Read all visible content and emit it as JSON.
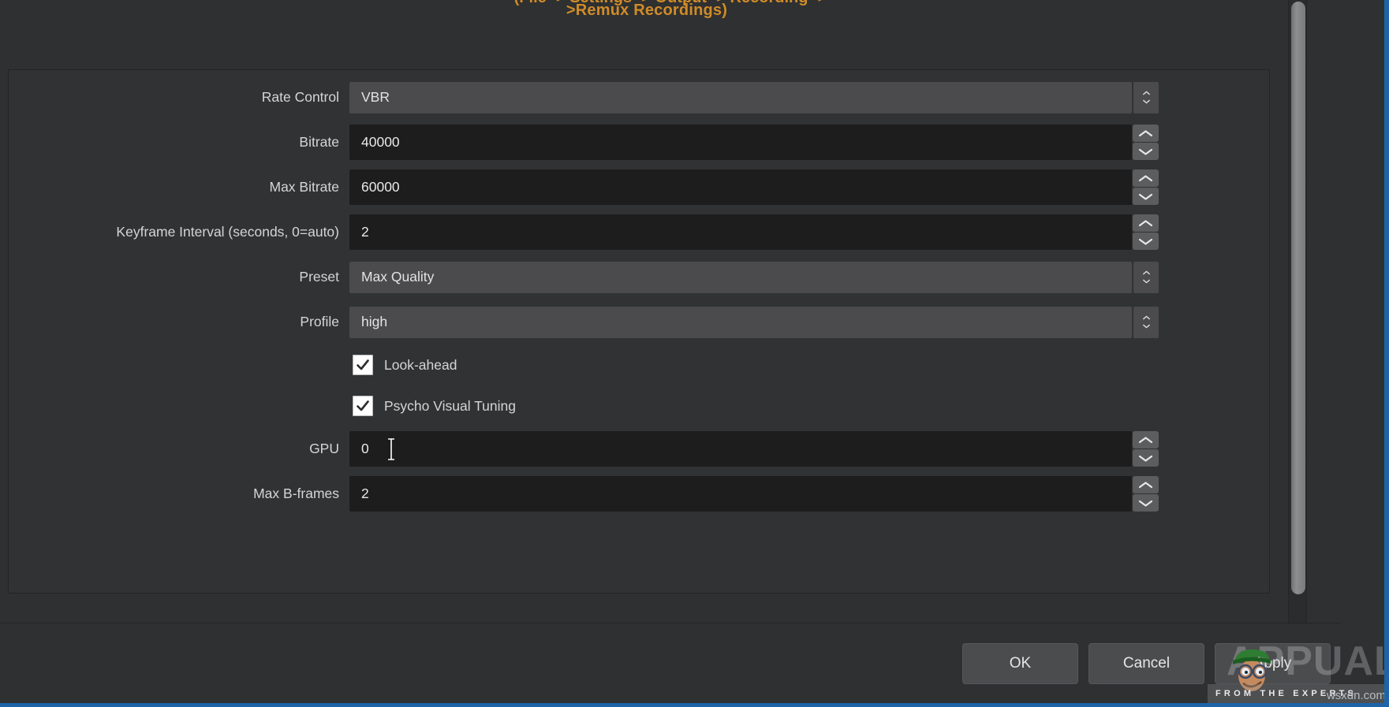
{
  "window": {
    "accent_color": "#1e64a8",
    "background_color": "#2f3031"
  },
  "settings": {
    "help_text": ">Remux Recordings)",
    "help_text_clipped_above": "(File -> Settings -> Output -> Recording ->",
    "help_text_color": "#d08b28",
    "groupbox_name": "encoder-settings"
  },
  "fields": [
    {
      "label": "Rate Control",
      "type": "combo",
      "value": "VBR",
      "name": "rate-control"
    },
    {
      "label": "Bitrate",
      "type": "spin",
      "value": "40000",
      "name": "bitrate"
    },
    {
      "label": "Max Bitrate",
      "type": "spin",
      "value": "60000",
      "name": "max-bitrate"
    },
    {
      "label": "Keyframe Interval (seconds, 0=auto)",
      "type": "spin",
      "value": "2",
      "name": "keyframe-interval"
    },
    {
      "label": "Preset",
      "type": "combo",
      "value": "Max Quality",
      "name": "preset"
    },
    {
      "label": "Profile",
      "type": "combo",
      "value": "high",
      "name": "profile"
    },
    {
      "label": "Look-ahead",
      "type": "checkbox",
      "checked": true,
      "name": "look-ahead"
    },
    {
      "label": "Psycho Visual Tuning",
      "type": "checkbox",
      "checked": true,
      "name": "psycho-visual-tuning"
    },
    {
      "label": "GPU",
      "type": "spin",
      "value": "0",
      "name": "gpu",
      "has_text_cursor": true
    },
    {
      "label": "Max B-frames",
      "type": "spin",
      "value": "2",
      "name": "max-b-frames"
    }
  ],
  "buttons": {
    "ok": "OK",
    "cancel": "Cancel",
    "apply": "Apply"
  },
  "scrollbar": {
    "orientation": "vertical",
    "thumb_position_percent": 0
  },
  "watermark": {
    "brand": "APPUALS",
    "tagline": "FROM THE EXPERTS",
    "site": "wsxdn.com"
  }
}
